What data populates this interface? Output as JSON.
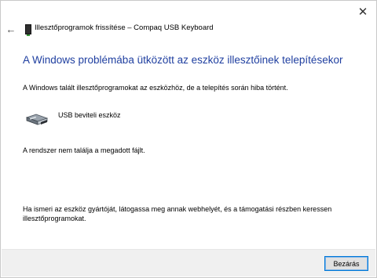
{
  "window": {
    "close_glyph": "✕",
    "back_glyph": "←",
    "title": "Illesztőprogramok frissítése – Compaq USB Keyboard"
  },
  "content": {
    "heading": "A Windows problémába ütközött az eszköz illesztőinek telepítésekor",
    "intro": "A Windows talált illesztőprogramokat az eszközhöz, de a telepítés során hiba történt.",
    "device_name": "USB beviteli eszköz",
    "error_message": "A rendszer nem találja a megadott fájlt.",
    "help_line1": "Ha ismeri az eszköz gyártóját, látogassa meg annak webhelyét, és a támogatási részben keressen",
    "help_line2": "illesztőprogramokat."
  },
  "footer": {
    "close_label": "Bezárás"
  },
  "colors": {
    "heading": "#1f3fa0",
    "button_border": "#0078d7"
  }
}
